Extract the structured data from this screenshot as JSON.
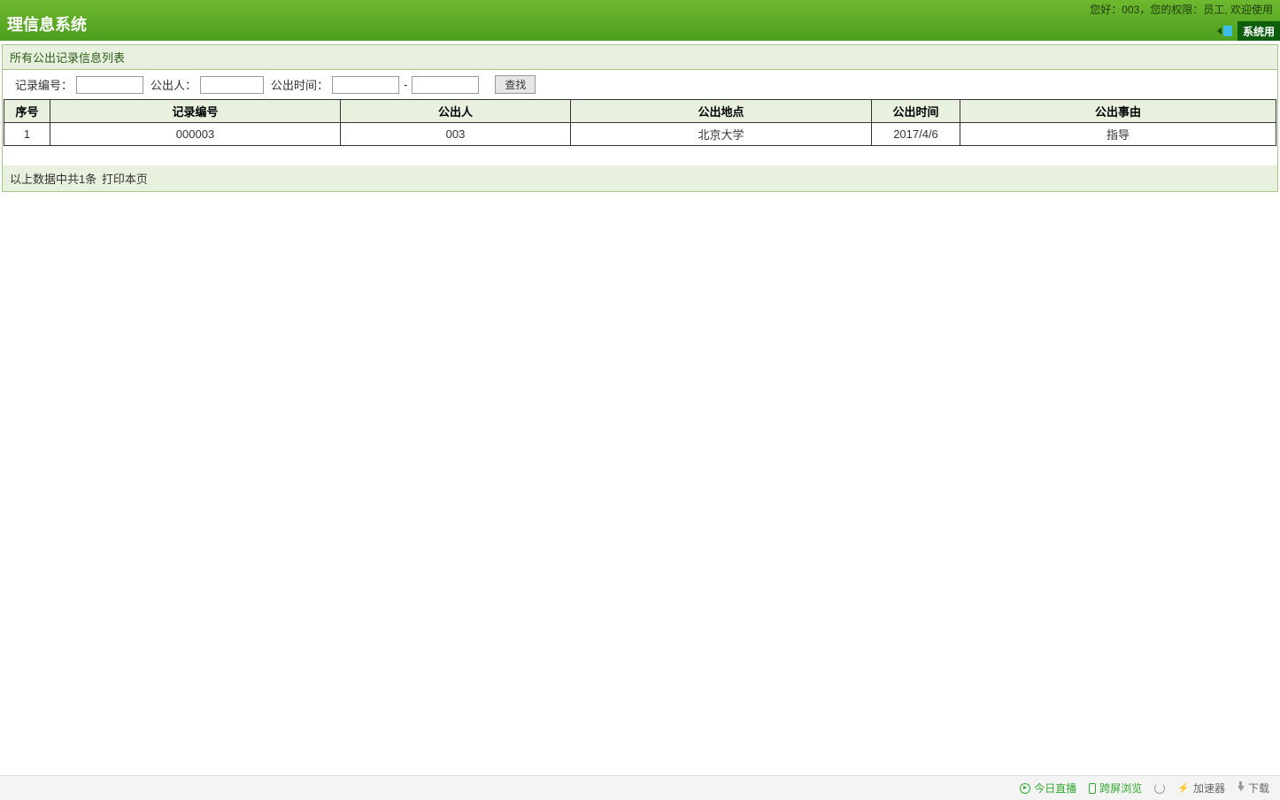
{
  "header": {
    "title": "理信息系统",
    "welcome": "您好：003，您的权限：员工, 欢迎使用",
    "nav_tab": "系统用"
  },
  "panel": {
    "title": "所有公出记录信息列表"
  },
  "search": {
    "record_label": "记录编号：",
    "person_label": "公出人：",
    "time_label": "公出时间：",
    "date_sep": "-",
    "button_label": "查找",
    "record_value": "",
    "person_value": "",
    "date_from": "",
    "date_to": ""
  },
  "table": {
    "headers": {
      "seq": "序号",
      "record": "记录编号",
      "person": "公出人",
      "place": "公出地点",
      "time": "公出时间",
      "reason": "公出事由"
    },
    "rows": [
      {
        "seq": "1",
        "record": "000003",
        "person": "003",
        "place": "北京大学",
        "time": "2017/4/6",
        "reason": "指导"
      }
    ]
  },
  "footer": {
    "summary": "以上数据中共1条",
    "print_link": "打印本页"
  },
  "status_bar": {
    "live": "今日直播",
    "cross": "跨屏浏览",
    "accel": "加速器",
    "download": "下载"
  }
}
